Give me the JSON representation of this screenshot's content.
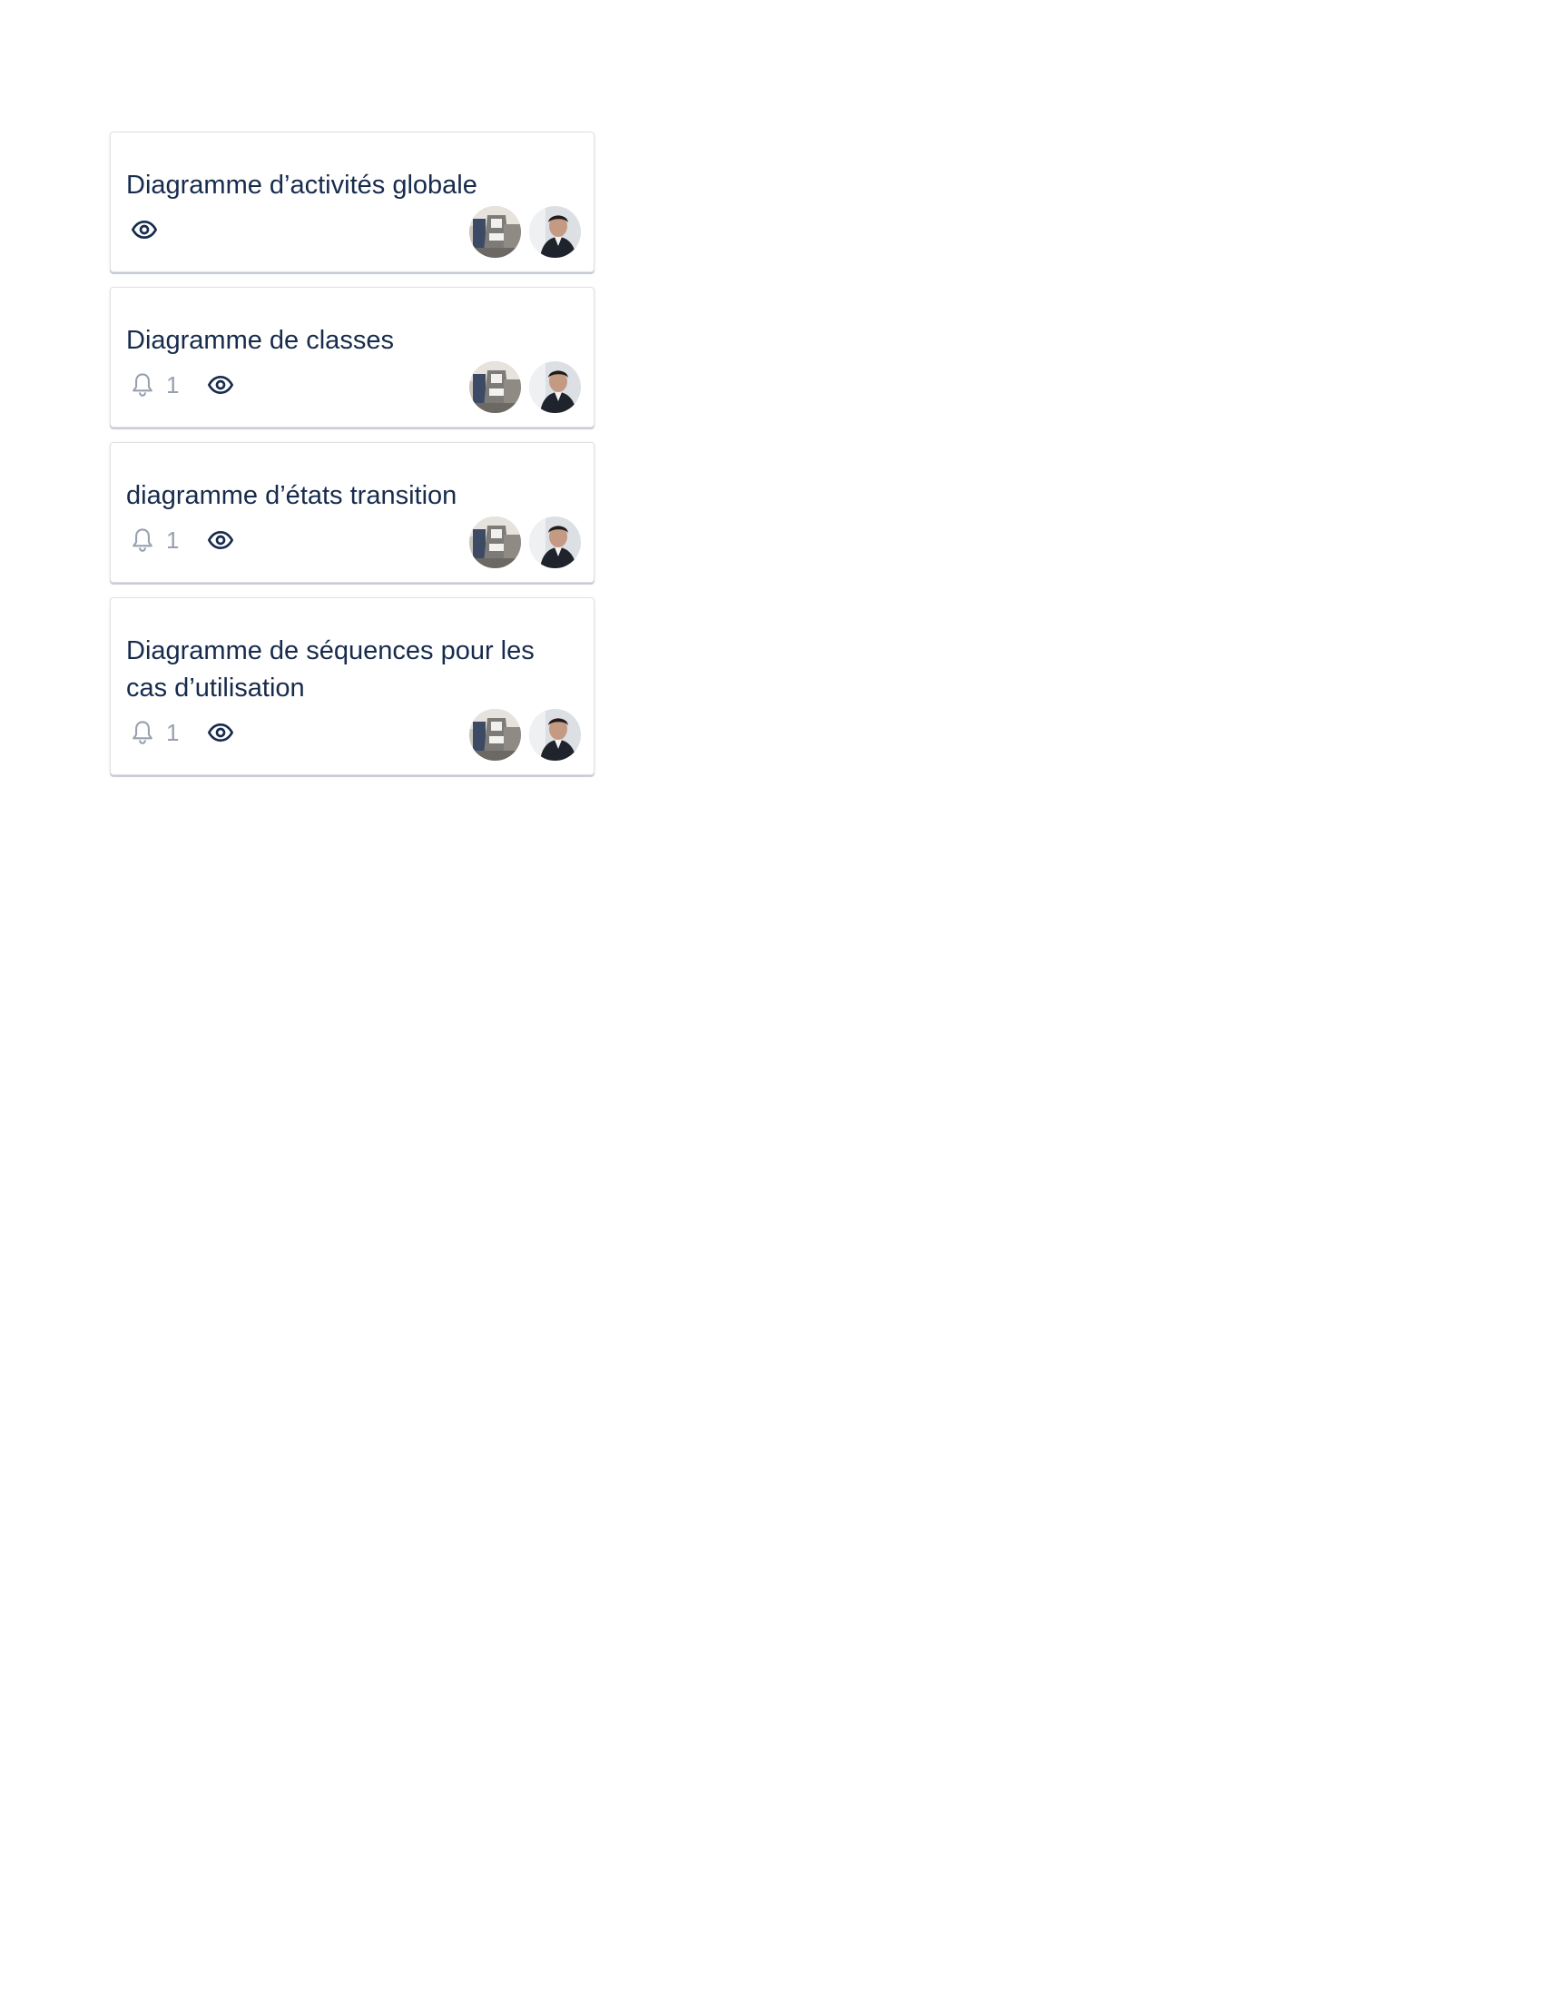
{
  "cards": [
    {
      "title": "Diagramme d’activités globale",
      "has_notification": false,
      "notification_count": "",
      "watch_icon": "eye-icon",
      "members": [
        "member-avatar-1",
        "member-avatar-2"
      ]
    },
    {
      "title": "Diagramme de classes",
      "has_notification": true,
      "notification_count": "1",
      "watch_icon": "eye-icon",
      "members": [
        "member-avatar-1",
        "member-avatar-2"
      ]
    },
    {
      "title": "diagramme d’états transition",
      "has_notification": true,
      "notification_count": "1",
      "watch_icon": "eye-icon",
      "members": [
        "member-avatar-1",
        "member-avatar-2"
      ]
    },
    {
      "title": "Diagramme de séquences pour les cas d’utilisation",
      "has_notification": true,
      "notification_count": "1",
      "watch_icon": "eye-icon",
      "members": [
        "member-avatar-1",
        "member-avatar-2"
      ]
    }
  ],
  "colors": {
    "title_text": "#172b4d",
    "badge_muted": "#97a0af",
    "eye_icon": "#172b4d"
  }
}
